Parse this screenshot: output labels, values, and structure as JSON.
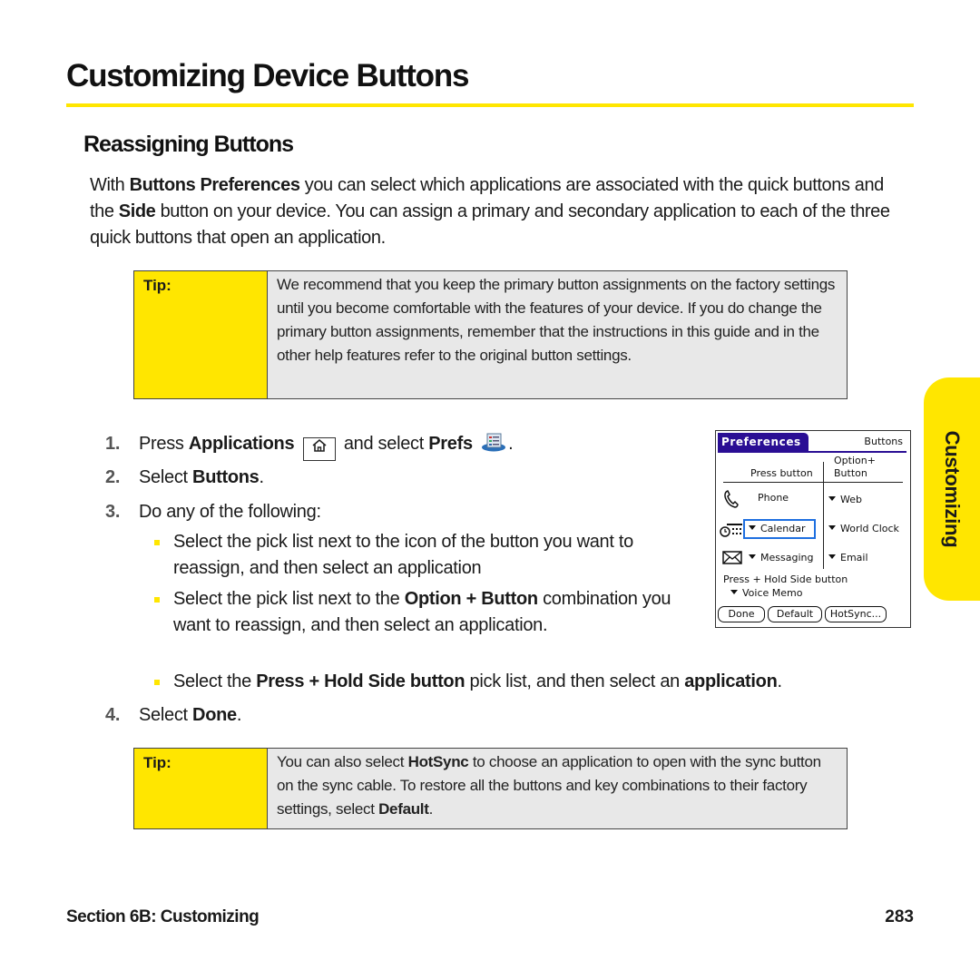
{
  "page": {
    "title": "Customizing Device Buttons",
    "section_heading": "Reassigning Buttons",
    "accent_color": "#ffe600"
  },
  "intro": {
    "p1": "With ",
    "b1": "Buttons Preferences",
    "p2": " you can select which applications are associated with the quick buttons and the ",
    "b2": "Side",
    "p3": " button on your device. You can assign a primary and secondary application to each of the three quick buttons that open an application."
  },
  "tip1": {
    "label": "Tip:",
    "text": "We recommend that you keep the primary button assignments on the factory settings until you become comfortable with the features of your device. If you do change the primary button assignments, remember that the instructions in this guide and in the other help features refer to the original button settings."
  },
  "steps": [
    {
      "num": "1.",
      "pre": "Press ",
      "b1": "Applications",
      "mid": " and select ",
      "b2": "Prefs",
      "post": ".",
      "icon1": "home-key-icon",
      "icon2": "prefs-app-icon"
    },
    {
      "num": "2.",
      "pre": "Select ",
      "b1": "Buttons",
      "post": "."
    },
    {
      "num": "3.",
      "pre": "Do any of the following:"
    },
    {
      "num": "4.",
      "pre": "Select ",
      "b1": "Done",
      "post": "."
    }
  ],
  "bullets": [
    {
      "text": "Select the pick list next to the icon of the button you want to reassign, and then select an application"
    },
    {
      "pre": "Select the pick list next to the ",
      "b1": "Option + Button",
      "post": " combination you want to reassign, and then select an application."
    },
    {
      "pre": "Select the ",
      "b1": "Press + Hold Side button",
      "mid": " pick list, and then select an ",
      "b2": "application",
      "post": "."
    }
  ],
  "palm_screen": {
    "title": "Preferences",
    "panel": "Buttons",
    "col1_header": "Press button",
    "col2_header_l1": "Option+",
    "col2_header_l2": "Button",
    "rows": [
      {
        "icon": "phone-icon",
        "primary": "Phone",
        "secondary": "Web"
      },
      {
        "icon": "calendar-icon",
        "primary": "Calendar",
        "secondary": "World Clock"
      },
      {
        "icon": "messaging-icon",
        "primary": "Messaging",
        "secondary": "Email"
      }
    ],
    "side_label": "Press + Hold Side button",
    "side_value": "Voice Memo",
    "buttons": [
      "Done",
      "Default",
      "HotSync..."
    ]
  },
  "tip2": {
    "label": "Tip:",
    "p1": "You can also select ",
    "b1": "HotSync",
    "p2": " to choose an application to open with the sync button on the sync cable. To restore all the buttons and key combinations to their factory settings, select ",
    "b2": "Default",
    "p3": "."
  },
  "side_tab": {
    "label": "Customizing"
  },
  "footer": {
    "section": "Section 6B: Customizing",
    "page_number": "283"
  }
}
